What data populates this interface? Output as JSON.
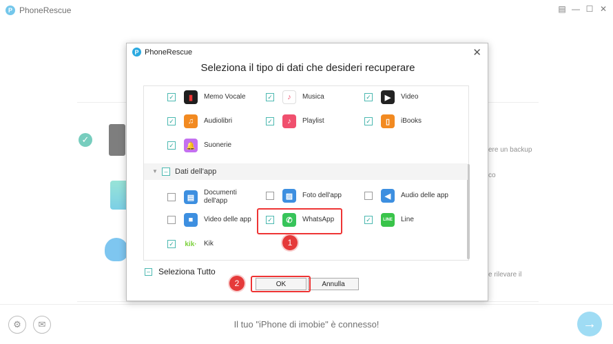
{
  "window": {
    "title": "PhoneRescue",
    "controls": [
      "menu-icon",
      "minimize-icon",
      "maximize-icon",
      "close-icon"
    ]
  },
  "background": {
    "text_backup": "ere un backup",
    "text_co": "co",
    "text_rilevare": "e rilevare il"
  },
  "bottom": {
    "status": "Il tuo \"iPhone di imobie\" è connesso!"
  },
  "dialog": {
    "title": "PhoneRescue",
    "heading": "Seleziona il tipo di dati che desideri recuperare",
    "media_items": [
      {
        "label": "Memo Vocale",
        "checked": true,
        "icon": "voice-memo-icon",
        "color": "#1e1e1e"
      },
      {
        "label": "Musica",
        "checked": true,
        "icon": "music-icon",
        "color": "#ffffff"
      },
      {
        "label": "Video",
        "checked": true,
        "icon": "video-clapper-icon",
        "color": "#222222"
      },
      {
        "label": "Audiolibri",
        "checked": true,
        "icon": "audiobook-icon",
        "color": "#f28a21"
      },
      {
        "label": "Playlist",
        "checked": true,
        "icon": "playlist-icon",
        "color": "#f0506e"
      },
      {
        "label": "iBooks",
        "checked": true,
        "icon": "ibooks-icon",
        "color": "#f28a21"
      },
      {
        "label": "Suonerie",
        "checked": true,
        "icon": "ringtone-icon",
        "color": "#c470f0"
      }
    ],
    "section_label": "Dati dell'app",
    "app_items": [
      {
        "label": "Documenti dell'app",
        "checked": false,
        "icon": "documents-icon",
        "color": "#3d8fe0"
      },
      {
        "label": "Foto dell'app",
        "checked": false,
        "icon": "photo-icon",
        "color": "#3d8fe0"
      },
      {
        "label": "Audio delle app",
        "checked": false,
        "icon": "audio-icon",
        "color": "#3d8fe0"
      },
      {
        "label": "Video delle app",
        "checked": false,
        "icon": "video-camera-icon",
        "color": "#3d8fe0"
      },
      {
        "label": "WhatsApp",
        "checked": true,
        "icon": "whatsapp-icon",
        "color": "#37c45a"
      },
      {
        "label": "Line",
        "checked": true,
        "icon": "line-icon",
        "color": "#39c44a"
      },
      {
        "label": "Kik",
        "checked": true,
        "icon": "kik-icon",
        "color": "#7ad03a"
      }
    ],
    "select_all": "Seleziona Tutto",
    "ok": "OK",
    "cancel": "Annulla",
    "badge1": "1",
    "badge2": "2"
  }
}
